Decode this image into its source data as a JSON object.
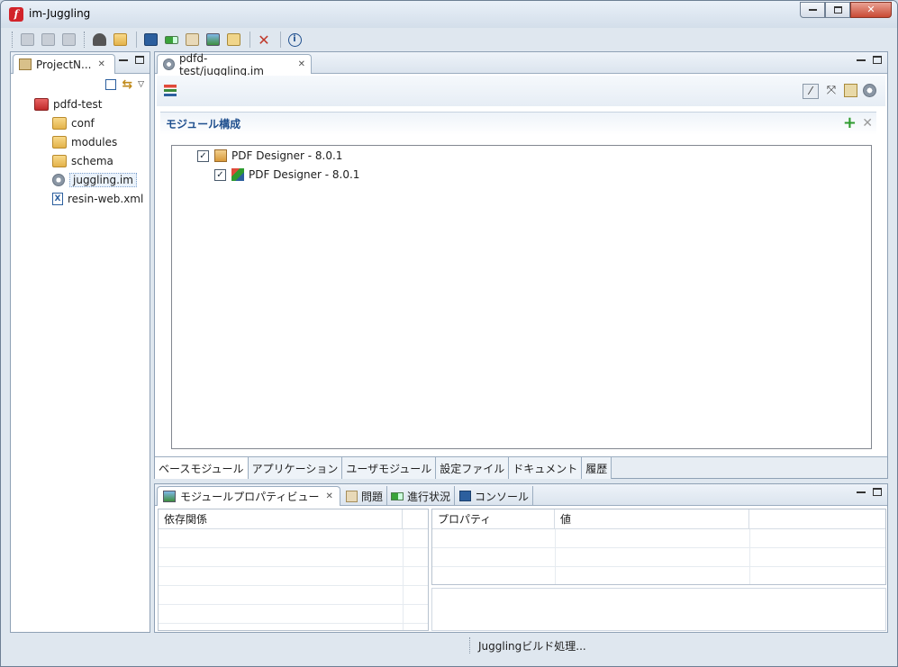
{
  "window": {
    "title": "im-Juggling",
    "min": "▭",
    "max": "▢",
    "close": "✕"
  },
  "toolbar": {
    "icons": [
      "save-icon",
      "save-as-icon",
      "save-all-icon",
      "build-icon",
      "open-folder-icon",
      "monitor-icon",
      "progress-icon",
      "problems-icon",
      "image-icon",
      "tree-icon",
      "tools-icon",
      "info-icon"
    ]
  },
  "project_nav": {
    "tab_label": "ProjectN...",
    "root": "pdfd-test",
    "items": [
      "conf",
      "modules",
      "schema",
      "juggling.im",
      "resin-web.xml"
    ]
  },
  "editor": {
    "tab_label": "pdfd-test/juggling.im",
    "section_title": "モジュール構成",
    "modules": [
      {
        "label": "PDF Designer - 8.0.1",
        "checked": true
      },
      {
        "label": "PDF Designer - 8.0.1",
        "checked": true
      }
    ],
    "bottom_tabs": [
      "ベースモジュール",
      "アプリケーション",
      "ユーザモジュール",
      "設定ファイル",
      "ドキュメント",
      "履歴"
    ],
    "active_tab_index": 0
  },
  "lower": {
    "tabs": [
      "モジュールプロパティビュー",
      "問題",
      "進行状況",
      "コンソール"
    ],
    "dependency_header": "依存関係",
    "property_header": "プロパティ",
    "value_header": "値"
  },
  "status_bar": {
    "text": "Jugglingビルド処理..."
  },
  "colors": {
    "accent": "#1f4f8e",
    "add": "#2e9b2e",
    "disabled": "#9a9a9a"
  }
}
